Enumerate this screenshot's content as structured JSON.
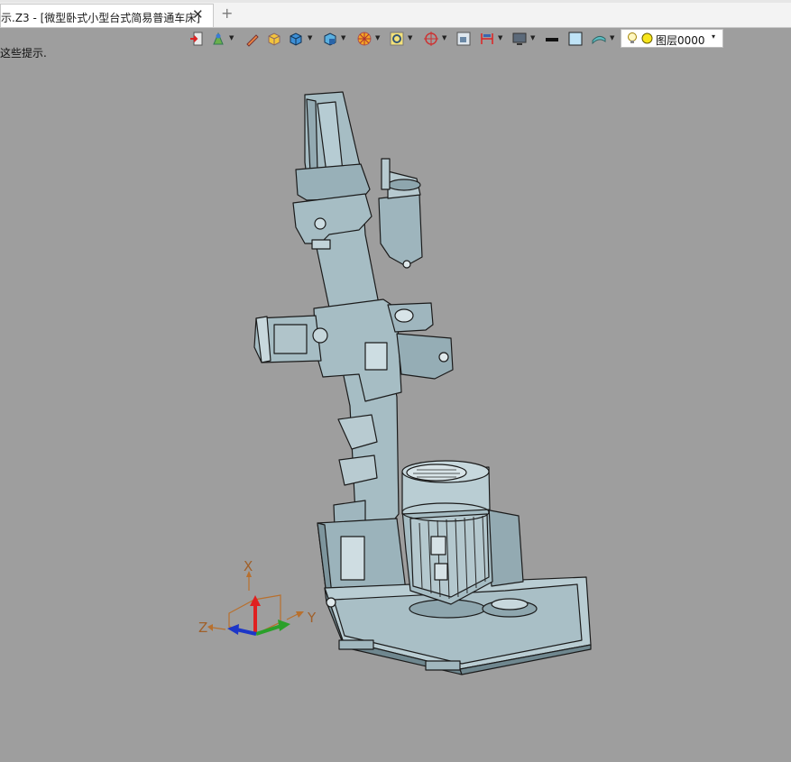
{
  "tab": {
    "title": "示.Z3 - [微型卧式小型台式简易普通车床]",
    "close_glyph": "✕",
    "add_glyph": "+"
  },
  "hint": {
    "text": "这些提示."
  },
  "toolbar": {
    "icons": [
      "exit-icon",
      "paint-icon",
      "pen-icon",
      "box-icon",
      "cube-icon",
      "cube-section-icon",
      "wheel-icon",
      "view-icon",
      "target-icon",
      "frame-icon",
      "dimension-icon",
      "display-icon",
      "line-black-icon",
      "color-square-icon",
      "surface-icon"
    ],
    "layer": {
      "label": "图层0000",
      "arrow": "▾"
    }
  },
  "triad": {
    "x": "X",
    "y": "Y",
    "z": "Z",
    "colors": {
      "x": "#e02020",
      "y": "#2aa02a",
      "z": "#1c36c8"
    }
  },
  "model": {
    "fill": "#a6bdc4",
    "stroke": "#1b1b1b"
  }
}
